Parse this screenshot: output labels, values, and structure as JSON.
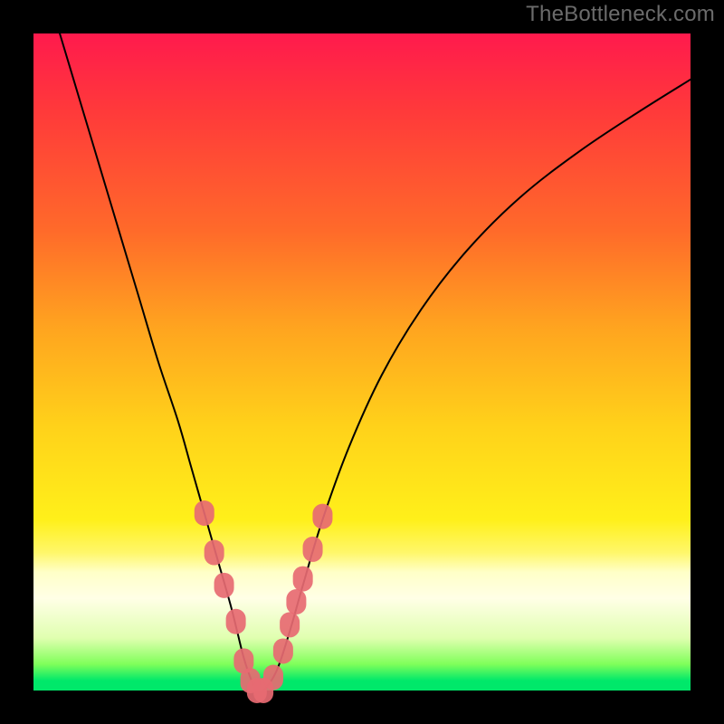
{
  "watermark": "TheBottleneck.com",
  "colors": {
    "curve": "#000000",
    "marker_fill": "#e76a72",
    "marker_fill_light": "#ec8b91",
    "bg_black": "#000000"
  },
  "chart_data": {
    "type": "line",
    "title": "",
    "xlabel": "",
    "ylabel": "",
    "xlim": [
      0,
      100
    ],
    "ylim": [
      0,
      100
    ],
    "grid": false,
    "legend": false,
    "series": [
      {
        "name": "bottleneck-curve",
        "x": [
          4,
          7,
          10,
          13,
          16,
          19,
          22,
          24,
          26,
          28,
          30,
          31,
          32,
          33,
          34,
          35,
          37,
          39,
          41,
          44,
          48,
          53,
          59,
          66,
          74,
          83,
          92,
          100
        ],
        "values": [
          100,
          90,
          80,
          70,
          60,
          50,
          41,
          34,
          27,
          20,
          13,
          9,
          5,
          2,
          0,
          0,
          3,
          9,
          16,
          26,
          37,
          48,
          58,
          67,
          75,
          82,
          88,
          93
        ]
      }
    ],
    "markers": {
      "name": "highlighted-points",
      "shape": "rounded-rect",
      "x": [
        26.0,
        27.5,
        29.0,
        30.8,
        32.0,
        33.0,
        34.0,
        35.0,
        36.5,
        38.0,
        39.0,
        40.0,
        41.0,
        42.5,
        44.0
      ],
      "values": [
        27.0,
        21.0,
        16.0,
        10.5,
        4.5,
        1.5,
        0.0,
        0.0,
        2.0,
        6.0,
        10.0,
        13.5,
        17.0,
        21.5,
        26.5
      ]
    }
  }
}
